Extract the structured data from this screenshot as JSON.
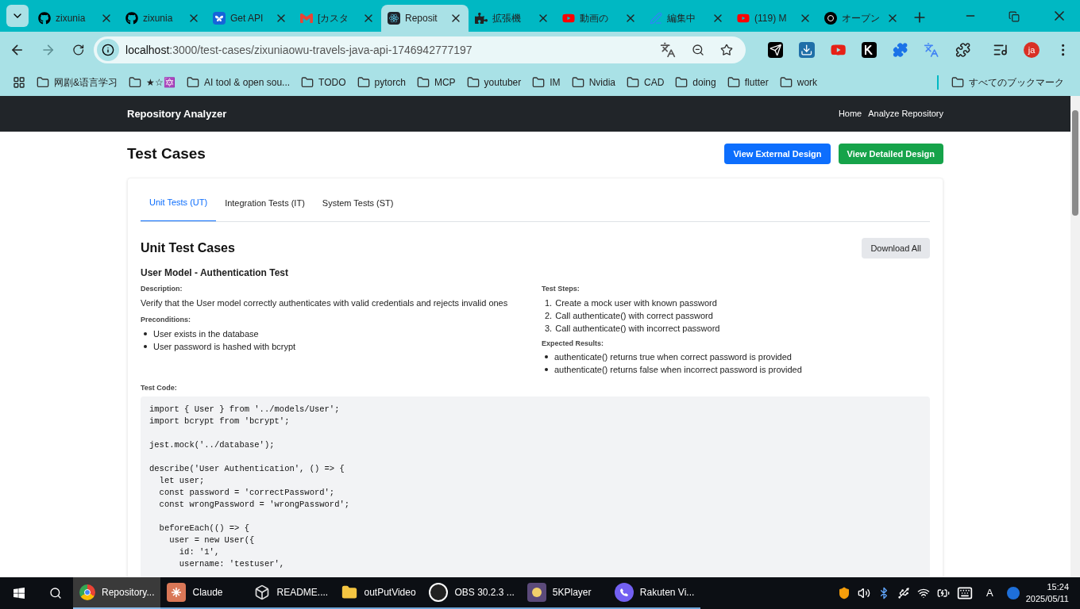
{
  "browser": {
    "tabs": [
      {
        "kind": "github",
        "title": "zixunia",
        "selected": false
      },
      {
        "kind": "github",
        "title": "zixunia",
        "selected": false
      },
      {
        "kind": "butterfly",
        "title": "Get API",
        "selected": false
      },
      {
        "kind": "gmail",
        "title": "[カスタ",
        "selected": false
      },
      {
        "kind": "react",
        "title": "Reposit",
        "selected": true
      },
      {
        "kind": "puzzle",
        "title": "拡張機",
        "selected": false
      },
      {
        "kind": "youtube",
        "title": "動画の",
        "selected": false
      },
      {
        "kind": "pen",
        "title": "編集中",
        "selected": false
      },
      {
        "kind": "youtube",
        "title": "(119) M",
        "selected": false
      },
      {
        "kind": "swirl",
        "title": "オープン",
        "selected": false
      }
    ],
    "address": {
      "host": "localhost",
      "path": ":3000/test-cases/zixuniaowu-travels-java-api-1746942777197"
    },
    "profile": "ja",
    "bookmarks": [
      "网剧&语言学习",
      "★☆🔯",
      "AI tool & open sou...",
      "TODO",
      "pytorch",
      "MCP",
      "youtuber",
      "IM",
      "Nvidia",
      "CAD",
      "doing",
      "flutter",
      "work"
    ],
    "all_bookmarks": "すべてのブックマーク"
  },
  "navbar": {
    "brand": "Repository Analyzer",
    "links": [
      "Home",
      "Analyze Repository"
    ]
  },
  "page": {
    "title": "Test Cases",
    "buttons": [
      {
        "label": "View External Design",
        "color": "#0d6efd"
      },
      {
        "label": "View Detailed Design",
        "color": "#16a34a"
      }
    ]
  },
  "test_tabs": [
    {
      "label": "Unit Tests (UT)",
      "selected": true
    },
    {
      "label": "Integration Tests (IT)",
      "selected": false
    },
    {
      "label": "System Tests (ST)",
      "selected": false
    }
  ],
  "section": {
    "title": "Unit Test Cases",
    "download": "Download All"
  },
  "test_case": {
    "name": "User Model - Authentication Test",
    "description_label": "Description:",
    "description": "Verify that the User model correctly authenticates with valid credentials and rejects invalid ones",
    "preconditions_label": "Preconditions:",
    "preconditions": [
      "User exists in the database",
      "User password is hashed with bcrypt"
    ],
    "steps_label": "Test Steps:",
    "steps": [
      {
        "number": "1.",
        "text": "Create a mock user with known password"
      },
      {
        "number": "2.",
        "text": "Call authenticate() with correct password"
      },
      {
        "number": "3.",
        "text": "Call authenticate() with incorrect password"
      }
    ],
    "expected_label": "Expected Results:",
    "expected": [
      "authenticate() returns true when correct password is provided",
      "authenticate() returns false when incorrect password is provided"
    ],
    "code_label": "Test Code:",
    "code": "import { User } from '../models/User';\nimport bcrypt from 'bcrypt';\n\njest.mock('../database');\n\ndescribe('User Authentication', () => {\n  let user;\n  const password = 'correctPassword';\n  const wrongPassword = 'wrongPassword';\n\n  beforeEach(() => {\n    user = new User({\n      id: '1',\n      username: 'testuser',"
  },
  "taskbar": {
    "apps": [
      {
        "kind": "chrome",
        "label": "Repository...",
        "selected": true
      },
      {
        "kind": "claude",
        "label": "Claude",
        "selected": false
      },
      {
        "kind": "cube",
        "label": "README....",
        "selected": false
      },
      {
        "kind": "folder",
        "label": "outPutVideo",
        "selected": false
      },
      {
        "kind": "obs",
        "label": "OBS 30.2.3 ...",
        "selected": false
      },
      {
        "kind": "player",
        "label": "5KPlayer",
        "selected": false
      },
      {
        "kind": "viber",
        "label": "Rakuten Vi...",
        "selected": false
      }
    ],
    "ime": "A",
    "time": "15:24",
    "date": "2025/05/11"
  }
}
